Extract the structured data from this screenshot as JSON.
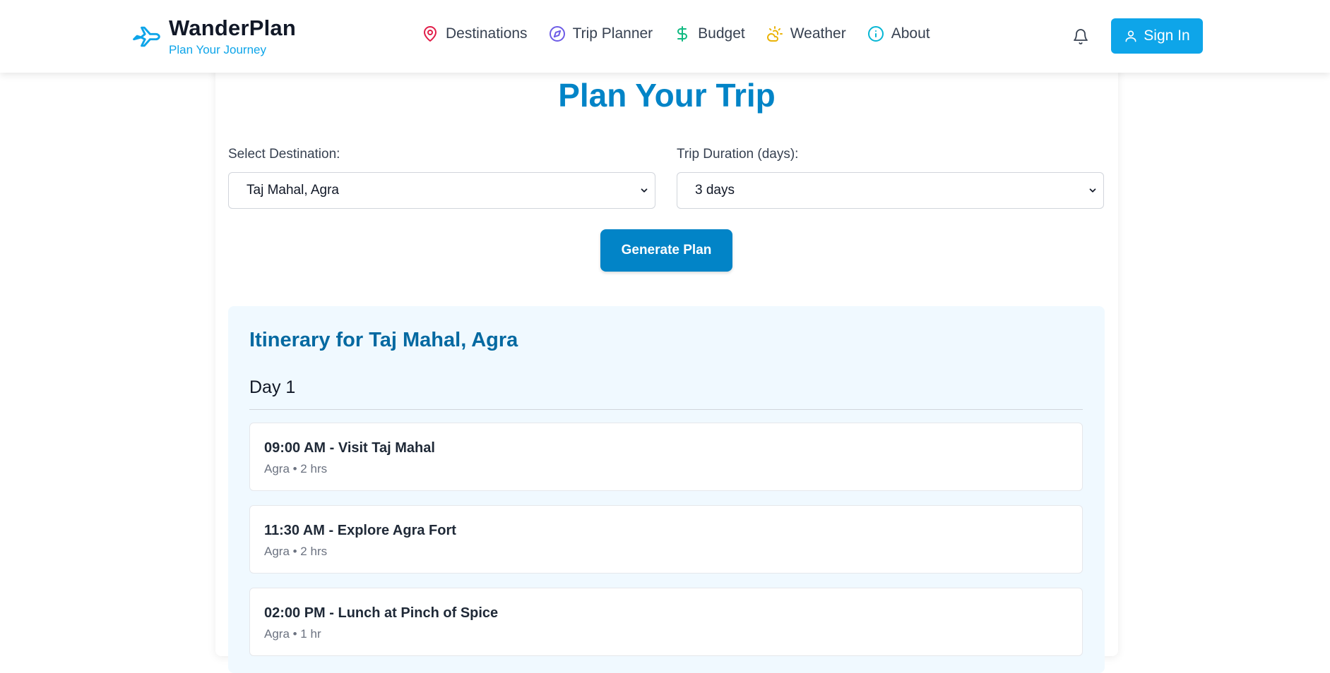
{
  "brand": {
    "title": "WanderPlan",
    "subtitle": "Plan Your Journey"
  },
  "nav": {
    "items": [
      {
        "label": "Destinations",
        "icon": "map-pin-icon",
        "color": "#e11d48"
      },
      {
        "label": "Trip Planner",
        "icon": "compass-icon",
        "color": "#6d5ce6"
      },
      {
        "label": "Budget",
        "icon": "dollar-icon",
        "color": "#10b981"
      },
      {
        "label": "Weather",
        "icon": "cloud-sun-icon",
        "color": "#eab308"
      },
      {
        "label": "About",
        "icon": "info-icon",
        "color": "#06b6d4"
      }
    ]
  },
  "header": {
    "signin_label": "Sign In",
    "bell_icon": "bell-icon"
  },
  "main": {
    "title": "Plan Your Trip",
    "destination_label": "Select Destination:",
    "destination_value": "Taj Mahal, Agra",
    "duration_label": "Trip Duration (days):",
    "duration_value": "3 days",
    "generate_label": "Generate Plan"
  },
  "itinerary": {
    "title": "Itinerary for Taj Mahal, Agra",
    "days": [
      {
        "label": "Day 1",
        "activities": [
          {
            "title": "09:00 AM - Visit Taj Mahal",
            "meta": "Agra • 2 hrs"
          },
          {
            "title": "11:30 AM - Explore Agra Fort",
            "meta": "Agra • 2 hrs"
          },
          {
            "title": "02:00 PM - Lunch at Pinch of Spice",
            "meta": "Agra • 1 hr"
          }
        ]
      }
    ]
  },
  "colors": {
    "accent": "#0ea5e9",
    "primary": "#0284c7",
    "itinerary_bg": "#f0f9ff"
  }
}
